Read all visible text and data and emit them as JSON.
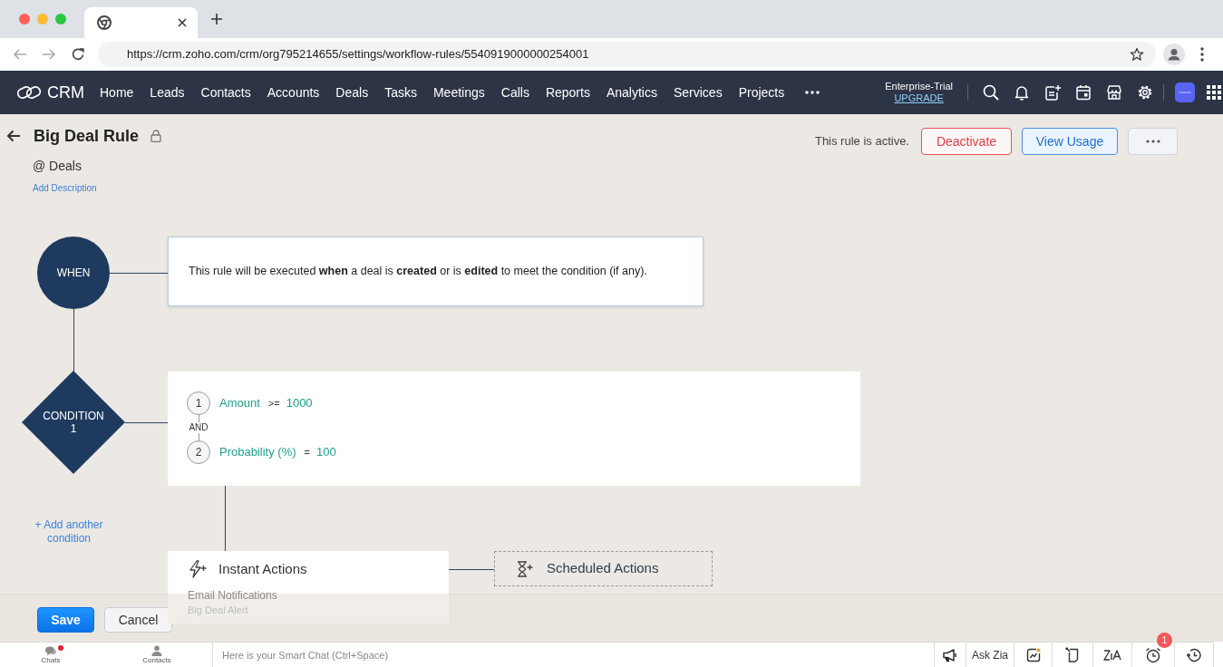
{
  "browser": {
    "url": "https://crm.zoho.com/crm/org795214655/settings/workflow-rules/5540919000000254001"
  },
  "navbar": {
    "brand": "CRM",
    "items": [
      "Home",
      "Leads",
      "Contacts",
      "Accounts",
      "Deals",
      "Tasks",
      "Meetings",
      "Calls",
      "Reports",
      "Analytics",
      "Services",
      "Projects"
    ],
    "plan": "Enterprise-Trial",
    "upgrade": "UPGRADE"
  },
  "rule": {
    "title": "Big Deal Rule",
    "module": "@ Deals",
    "add_description": "Add Description",
    "status": "This rule is active.",
    "buttons": [
      {
        "kind": "danger",
        "label": "Deactivate"
      },
      {
        "kind": "info",
        "label": "View Usage"
      },
      {
        "kind": "more"
      }
    ]
  },
  "when": {
    "label": "WHEN",
    "text": "This rule will be executed **when** a deal is **created** or is **edited** to meet the condition (if any)."
  },
  "condition": {
    "label": "CONDITION",
    "number": "1",
    "joiner": "AND",
    "criteria": [
      {
        "index": "1",
        "field": "Amount",
        "operator": ">=",
        "value": "1000"
      },
      {
        "index": "2",
        "field": "Probability (%)",
        "operator": "=",
        "value": "100"
      }
    ]
  },
  "add_condition": "+ Add another condition",
  "instant_actions": {
    "title": "Instant Actions",
    "items": [
      {
        "type": "Email Notifications",
        "name": "Big Deal Alert"
      }
    ]
  },
  "scheduled_actions": {
    "title": "Scheduled Actions"
  },
  "footer_buttons": [
    {
      "kind": "primary",
      "label": "Save"
    },
    {
      "kind": "secondary",
      "label": "Cancel"
    }
  ],
  "bottom_bar": {
    "items": [
      {
        "label": "Chats",
        "unread": true
      },
      {
        "label": "Contacts",
        "unread": false
      }
    ],
    "chat_placeholder": "Here is your Smart Chat (Ctrl+Space)",
    "ask_zia": "Ask Zia",
    "reminder_count": "1"
  }
}
